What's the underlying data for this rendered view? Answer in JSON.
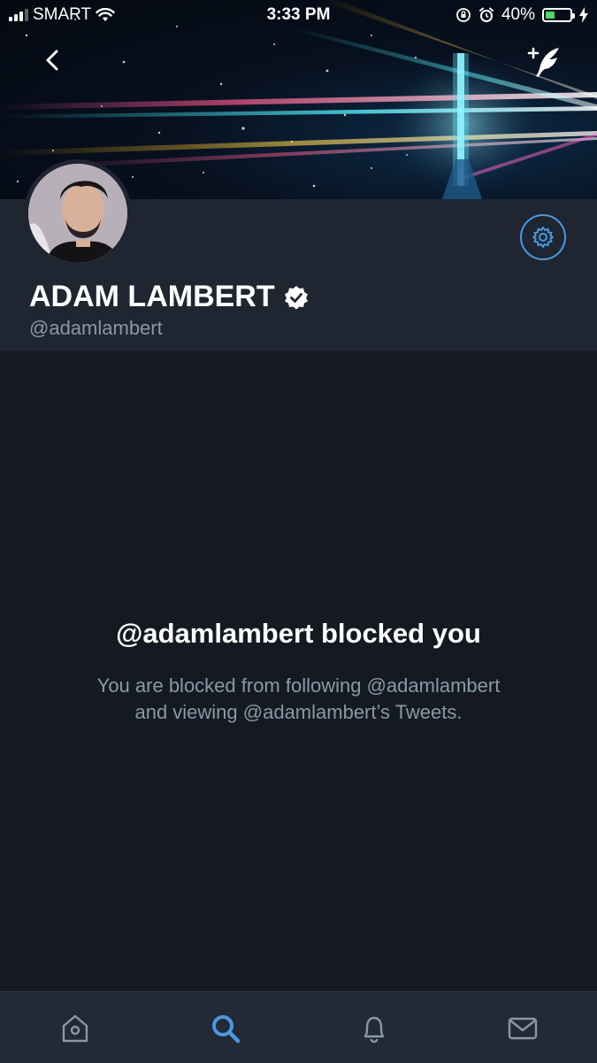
{
  "status_bar": {
    "carrier": "SMART",
    "time": "3:33 PM",
    "battery_percent": "40%",
    "battery_level": 0.4,
    "battery_color": "#4cd964"
  },
  "header": {
    "back_icon": "chevron-left-icon",
    "compose_icon": "compose-tweet-icon"
  },
  "profile": {
    "display_name": "ADAM LAMBERT",
    "handle": "@adamlambert",
    "verified_icon": "verified-badge-icon",
    "settings_icon": "gear-icon"
  },
  "blocked": {
    "title": "@adamlambert blocked you",
    "line1": "You are blocked from following @adamlambert",
    "line2": "and viewing @adamlambert’s Tweets."
  },
  "tabbar": {
    "tabs": [
      {
        "name": "home",
        "icon": "home-icon",
        "active": false
      },
      {
        "name": "search",
        "icon": "search-icon",
        "active": true
      },
      {
        "name": "notifications",
        "icon": "bell-icon",
        "active": false
      },
      {
        "name": "messages",
        "icon": "envelope-icon",
        "active": false
      }
    ],
    "active_color": "#4a98e0",
    "inactive_color": "#8899a6"
  },
  "colors": {
    "background": "#151a22",
    "panel": "#1f2631",
    "accent": "#4a98e0",
    "secondary_text": "#8899a6"
  }
}
